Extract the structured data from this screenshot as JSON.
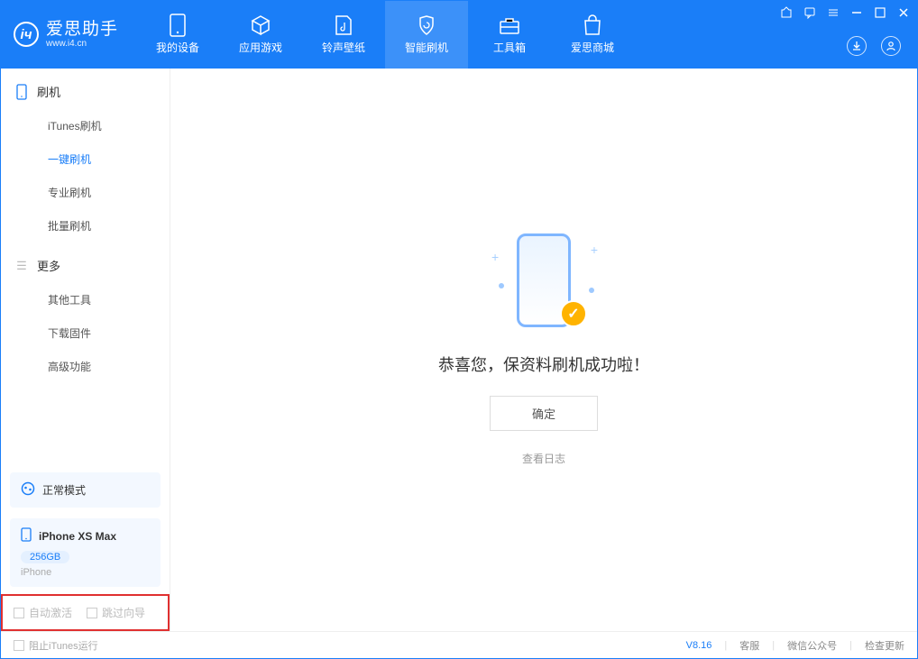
{
  "app": {
    "title": "爱思助手",
    "subtitle": "www.i4.cn"
  },
  "nav": [
    {
      "label": "我的设备"
    },
    {
      "label": "应用游戏"
    },
    {
      "label": "铃声壁纸"
    },
    {
      "label": "智能刷机"
    },
    {
      "label": "工具箱"
    },
    {
      "label": "爱思商城"
    }
  ],
  "sidebar": {
    "group1": {
      "title": "刷机",
      "items": [
        "iTunes刷机",
        "一键刷机",
        "专业刷机",
        "批量刷机"
      ]
    },
    "group2": {
      "title": "更多",
      "items": [
        "其他工具",
        "下载固件",
        "高级功能"
      ]
    }
  },
  "mode": {
    "label": "正常模式"
  },
  "device": {
    "name": "iPhone XS Max",
    "capacity": "256GB",
    "type": "iPhone"
  },
  "options": {
    "auto_activate": "自动激活",
    "skip_guide": "跳过向导"
  },
  "main": {
    "success": "恭喜您，保资料刷机成功啦！",
    "ok": "确定",
    "view_log": "查看日志"
  },
  "footer": {
    "block_itunes": "阻止iTunes运行",
    "version": "V8.16",
    "customer_service": "客服",
    "wechat": "微信公众号",
    "check_update": "检查更新"
  }
}
